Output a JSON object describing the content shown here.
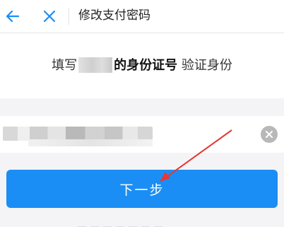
{
  "header": {
    "title": "修改支付密码",
    "back_icon": "arrow-left-icon",
    "close_icon": "close-icon",
    "accent_color": "#1a8ef5"
  },
  "instruction": {
    "prefix": "填写",
    "emphasis": "的身份证号",
    "suffix": " 验证身份"
  },
  "input": {
    "clear_icon": "clear-circle-icon"
  },
  "next_button": {
    "label": "下一步",
    "color": "#1a8ef5"
  },
  "annotation": {
    "arrow_color": "#e53935"
  }
}
